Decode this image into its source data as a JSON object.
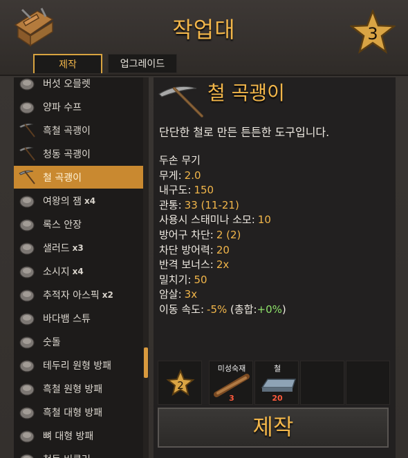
{
  "header": {
    "title": "작업대",
    "station_level": "3"
  },
  "tabs": [
    {
      "label": "제작"
    },
    {
      "label": "업그레이드"
    }
  ],
  "recipe_list": [
    {
      "label": "버섯 오믈렛",
      "qty": ""
    },
    {
      "label": "양파 수프",
      "qty": ""
    },
    {
      "label": "흑철 곡괭이",
      "qty": ""
    },
    {
      "label": "청동 곡괭이",
      "qty": ""
    },
    {
      "label": "철 곡괭이",
      "qty": "",
      "selected": true
    },
    {
      "label": "여왕의 잼",
      "qty": "x4"
    },
    {
      "label": "록스 안장",
      "qty": ""
    },
    {
      "label": "샐러드",
      "qty": "x3"
    },
    {
      "label": "소시지",
      "qty": "x4"
    },
    {
      "label": "추적자 아스픽",
      "qty": "x2"
    },
    {
      "label": "바다뱀 스튜",
      "qty": ""
    },
    {
      "label": "숫돌",
      "qty": ""
    },
    {
      "label": "테두리 원형 방패",
      "qty": ""
    },
    {
      "label": "흑철 원형 방패",
      "qty": ""
    },
    {
      "label": "흑철 대형 방패",
      "qty": ""
    },
    {
      "label": "뼈 대형 방패",
      "qty": ""
    },
    {
      "label": "청동 버클러",
      "qty": ""
    }
  ],
  "detail": {
    "name": "철 곡괭이",
    "description": "단단한 철로 만든 튼튼한 도구입니다.",
    "stats": [
      {
        "label": "두손 무기",
        "value": ""
      },
      {
        "label": "무게:",
        "value": "2.0"
      },
      {
        "label": "내구도:",
        "value": "150"
      },
      {
        "label": "관통:",
        "value": "33 (11-21)"
      },
      {
        "label": "사용시 스태미나 소모:",
        "value": "10"
      },
      {
        "label": "방어구 차단:",
        "value": "2 (2)"
      },
      {
        "label": "차단 방어력:",
        "value": "20"
      },
      {
        "label": "반격 보너스:",
        "value": "2x"
      },
      {
        "label": "밀치기:",
        "value": "50"
      },
      {
        "label": "암살:",
        "value": "3x"
      }
    ],
    "move_speed": {
      "label": "이동 속도:",
      "value": "-5%",
      "total_prefix": "(총합:",
      "total_value": "+0%",
      "total_suffix": ")"
    }
  },
  "requirements": {
    "required_level": "2",
    "materials": [
      {
        "name": "미성숙재",
        "amount": "3",
        "icon": "wood-log-icon"
      },
      {
        "name": "철",
        "amount": "20",
        "icon": "iron-bar-icon"
      }
    ]
  },
  "craft_button": {
    "label": "제작"
  },
  "colors": {
    "accent": "#f2b64a",
    "selected": "#c98930",
    "bonus_green": "#8fe36a",
    "amount_red": "#ff5a3c"
  }
}
